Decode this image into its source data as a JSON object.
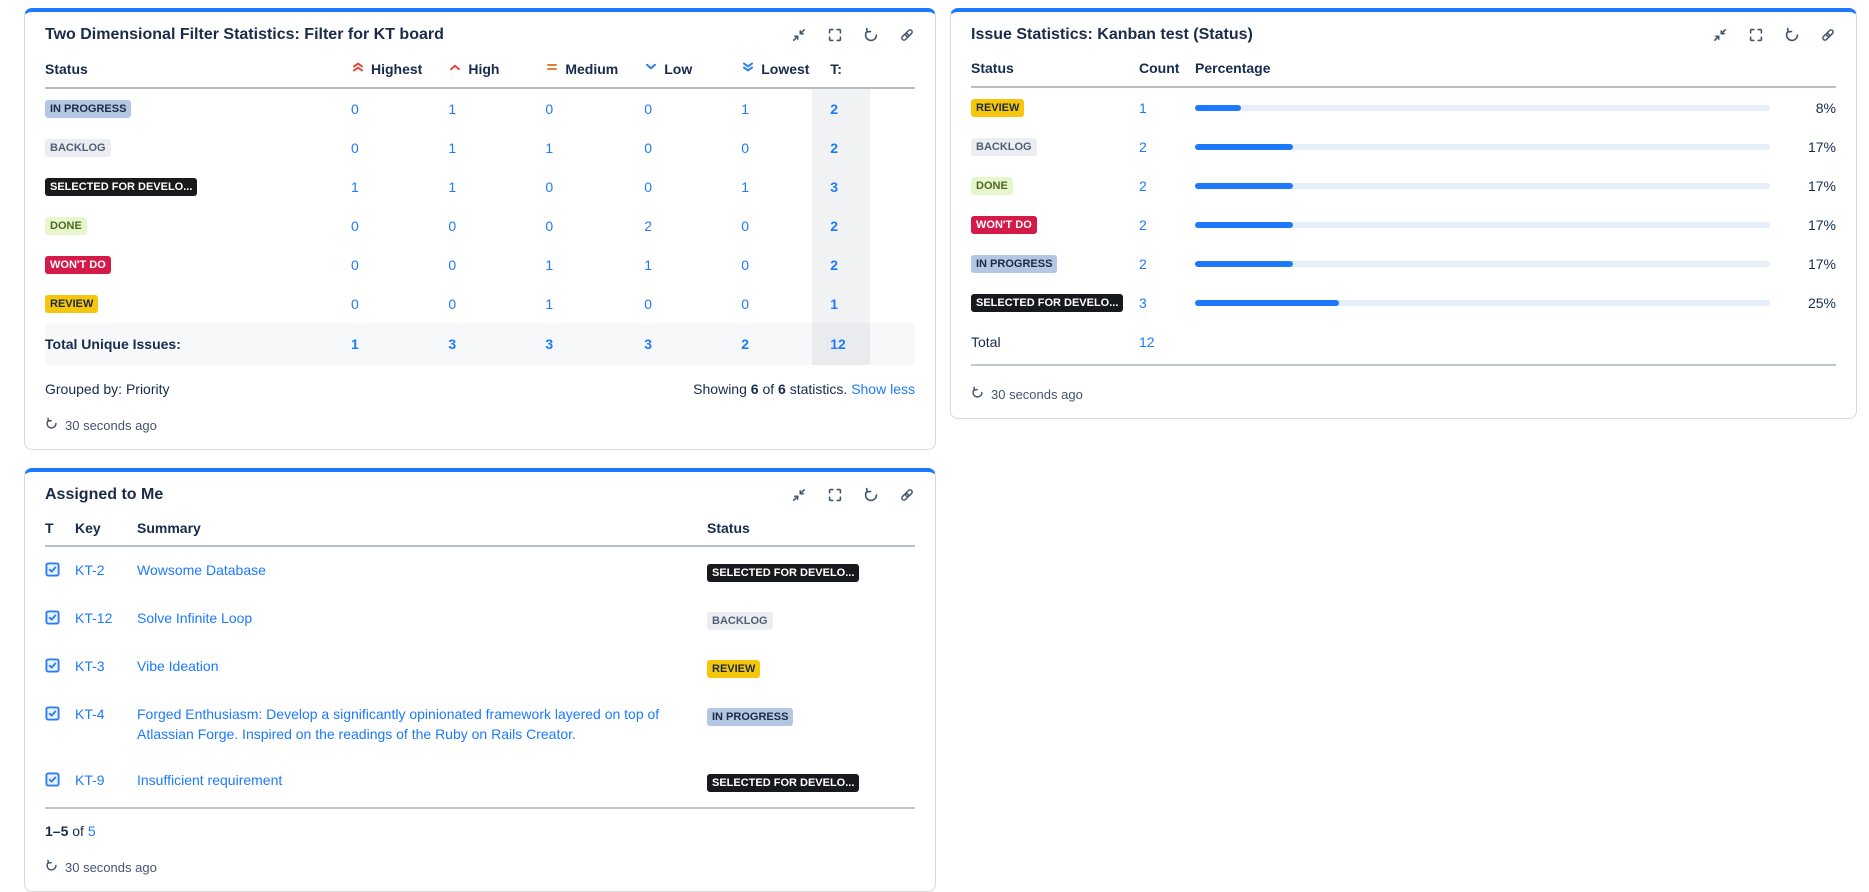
{
  "colors": {
    "accent_blue": "#1D7AFC",
    "link_blue": "#1D7AFC",
    "bar_track": "#E6EEF9",
    "bar_fill": "#1D7AFC",
    "priority_red": "#E2483D",
    "priority_orange": "#E97F33",
    "priority_blue": "#2E7EED"
  },
  "badges": {
    "IN PROGRESS": {
      "bg": "#B3C6E3",
      "fg": "#1C2B41"
    },
    "BACKLOG": {
      "bg": "#ECEDF0",
      "fg": "#505F79"
    },
    "SELECTED FOR DEVELO...": {
      "bg": "#17191C",
      "fg": "#FFFFFF"
    },
    "DONE": {
      "bg": "#E7F6CD",
      "fg": "#4C6B1F"
    },
    "WON'T DO": {
      "bg": "#D31A48",
      "fg": "#FFFFFF"
    },
    "REVIEW": {
      "bg": "#F5C60A",
      "fg": "#1C2B41"
    }
  },
  "two_dim": {
    "title": "Two Dimensional Filter Statistics: Filter for KT board",
    "status_header": "Status",
    "t_header": "T:",
    "priorities": [
      {
        "label": "Highest",
        "icon": "priority-highest"
      },
      {
        "label": "High",
        "icon": "priority-high"
      },
      {
        "label": "Medium",
        "icon": "priority-medium"
      },
      {
        "label": "Low",
        "icon": "priority-low"
      },
      {
        "label": "Lowest",
        "icon": "priority-lowest"
      }
    ],
    "rows": [
      {
        "status": "IN PROGRESS",
        "values": [
          "0",
          "1",
          "0",
          "0",
          "1"
        ],
        "total": "2"
      },
      {
        "status": "BACKLOG",
        "values": [
          "0",
          "1",
          "1",
          "0",
          "0"
        ],
        "total": "2"
      },
      {
        "status": "SELECTED FOR DEVELO...",
        "values": [
          "1",
          "1",
          "0",
          "0",
          "1"
        ],
        "total": "3"
      },
      {
        "status": "DONE",
        "values": [
          "0",
          "0",
          "0",
          "2",
          "0"
        ],
        "total": "2"
      },
      {
        "status": "WON'T DO",
        "values": [
          "0",
          "0",
          "1",
          "1",
          "0"
        ],
        "total": "2"
      },
      {
        "status": "REVIEW",
        "values": [
          "0",
          "0",
          "1",
          "0",
          "0"
        ],
        "total": "1"
      }
    ],
    "total_label": "Total Unique Issues:",
    "totals": [
      "1",
      "3",
      "3",
      "3",
      "2"
    ],
    "grand_total": "12",
    "grouped_by": "Grouped by: Priority",
    "showing": {
      "label_showing": "Showing",
      "count_a": "6",
      "label_of": "of",
      "count_b": "6",
      "label_statistics": "statistics.",
      "link": "Show less"
    },
    "updated": "30 seconds ago"
  },
  "issue_stats": {
    "title": "Issue Statistics: Kanban test (Status)",
    "columns": {
      "status": "Status",
      "count": "Count",
      "percentage": "Percentage"
    },
    "rows": [
      {
        "status": "REVIEW",
        "count": "1",
        "pct": 8,
        "pct_label": "8%"
      },
      {
        "status": "BACKLOG",
        "count": "2",
        "pct": 17,
        "pct_label": "17%"
      },
      {
        "status": "DONE",
        "count": "2",
        "pct": 17,
        "pct_label": "17%"
      },
      {
        "status": "WON'T DO",
        "count": "2",
        "pct": 17,
        "pct_label": "17%"
      },
      {
        "status": "IN PROGRESS",
        "count": "2",
        "pct": 17,
        "pct_label": "17%"
      },
      {
        "status": "SELECTED FOR DEVELO...",
        "count": "3",
        "pct": 25,
        "pct_label": "25%"
      }
    ],
    "total_label": "Total",
    "total_value": "12",
    "updated": "30 seconds ago"
  },
  "assigned": {
    "title": "Assigned to Me",
    "columns": {
      "t": "T",
      "key": "Key",
      "summary": "Summary",
      "status": "Status"
    },
    "rows": [
      {
        "key": "KT-2",
        "summary": "Wowsome Database",
        "status": "SELECTED FOR DEVELO..."
      },
      {
        "key": "KT-12",
        "summary": "Solve Infinite Loop",
        "status": "BACKLOG"
      },
      {
        "key": "KT-3",
        "summary": "Vibe Ideation",
        "status": "REVIEW"
      },
      {
        "key": "KT-4",
        "summary": "Forged Enthusiasm: Develop a significantly opinionated framework layered on top of Atlassian Forge. Inspired on the readings of the Ruby on Rails Creator.",
        "status": "IN PROGRESS"
      },
      {
        "key": "KT-9",
        "summary": "Insufficient requirement",
        "status": "SELECTED FOR DEVELO..."
      }
    ],
    "pagination": {
      "range": "1–5",
      "of": "of",
      "total": "5"
    },
    "updated": "30 seconds ago"
  },
  "chart_data": {
    "type": "bar",
    "title": "Issue Statistics: Kanban test (Status)",
    "categories": [
      "REVIEW",
      "BACKLOG",
      "DONE",
      "WON'T DO",
      "IN PROGRESS",
      "SELECTED FOR DEVELO..."
    ],
    "counts": [
      1,
      2,
      2,
      2,
      2,
      3
    ],
    "percentages": [
      8,
      17,
      17,
      17,
      17,
      25
    ],
    "total": 12,
    "xlabel": "Percentage",
    "ylabel": "Status",
    "xlim": [
      0,
      100
    ]
  }
}
